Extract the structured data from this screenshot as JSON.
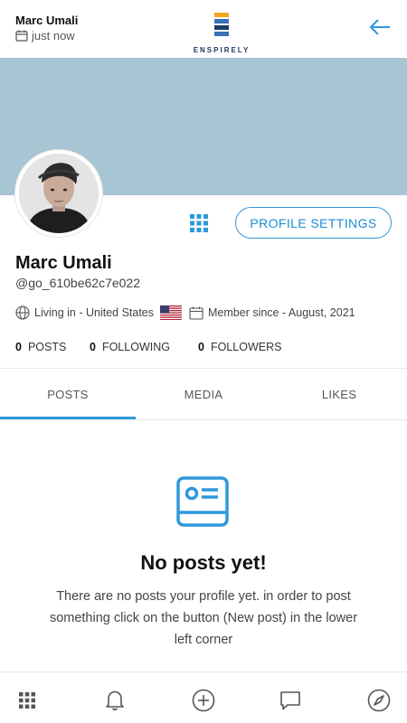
{
  "header": {
    "user_name": "Marc Umali",
    "timestamp": "just now",
    "logo_text": "ENSPIRELY",
    "back_icon": "arrow-left-icon"
  },
  "profile": {
    "name": "Marc Umali",
    "handle": "@go_610be62c7e022",
    "location": "Living in - United States",
    "member_since": "Member since - August, 2021",
    "settings_label": "PROFILE SETTINGS"
  },
  "stats": {
    "posts_count": "0",
    "posts_label": "POSTS",
    "following_count": "0",
    "following_label": "FOLLOWING",
    "followers_count": "0",
    "followers_label": "FOLLOWERS"
  },
  "tabs": [
    {
      "label": "POSTS",
      "active": true
    },
    {
      "label": "MEDIA",
      "active": false
    },
    {
      "label": "LIKES",
      "active": false
    }
  ],
  "empty_state": {
    "title": "No posts yet!",
    "text": "There are no posts your profile yet. in order to post something click on the button (New post) in the lower left corner"
  },
  "bottom_nav": [
    "grid-icon",
    "bell-icon",
    "plus-circle-icon",
    "chat-icon",
    "compass-icon"
  ],
  "colors": {
    "accent": "#2f98dc",
    "cover": "#a7c5d3",
    "text": "#222222"
  }
}
